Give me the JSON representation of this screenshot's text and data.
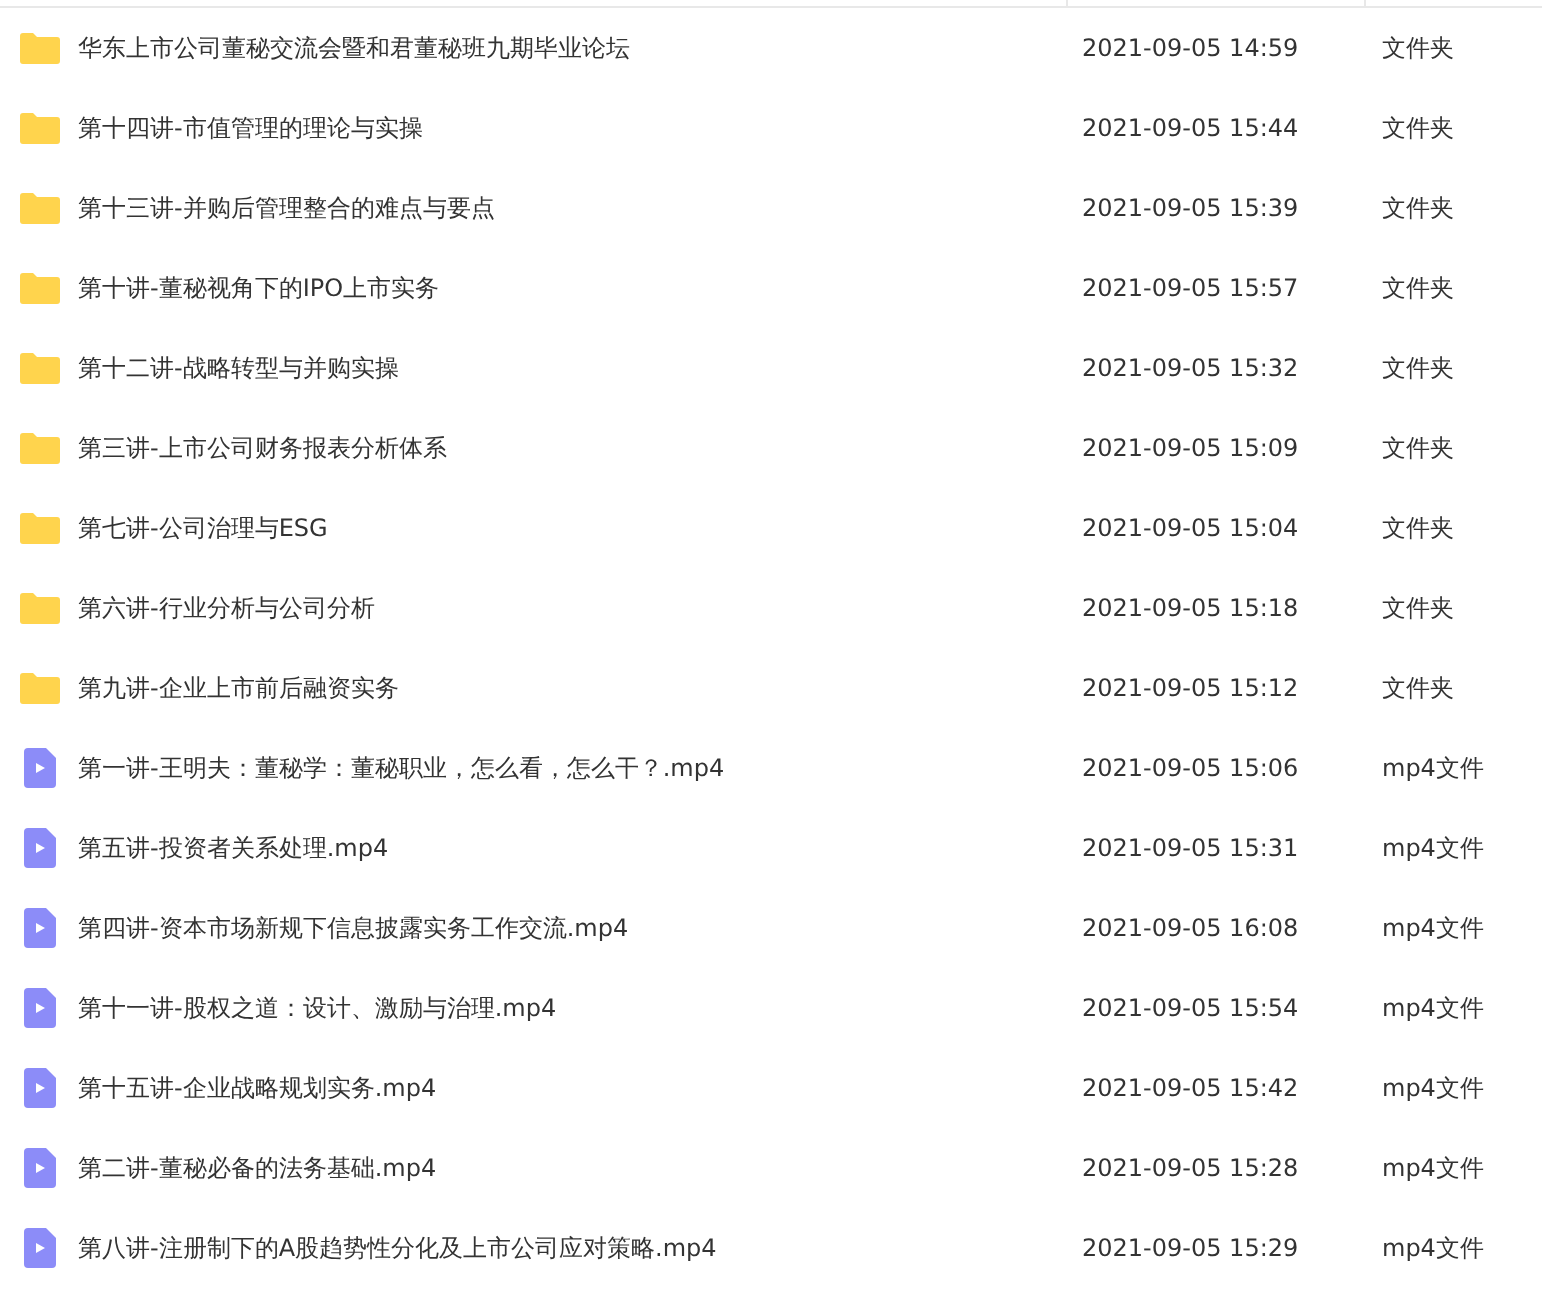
{
  "files": [
    {
      "kind": "folder",
      "name": "华东上市公司董秘交流会暨和君董秘班九期毕业论坛",
      "modified": "2021-09-05 14:59",
      "type": "文件夹"
    },
    {
      "kind": "folder",
      "name": "第十四讲-市值管理的理论与实操",
      "modified": "2021-09-05 15:44",
      "type": "文件夹"
    },
    {
      "kind": "folder",
      "name": "第十三讲-并购后管理整合的难点与要点",
      "modified": "2021-09-05 15:39",
      "type": "文件夹"
    },
    {
      "kind": "folder",
      "name": "第十讲-董秘视角下的IPO上市实务",
      "modified": "2021-09-05 15:57",
      "type": "文件夹"
    },
    {
      "kind": "folder",
      "name": "第十二讲-战略转型与并购实操",
      "modified": "2021-09-05 15:32",
      "type": "文件夹"
    },
    {
      "kind": "folder",
      "name": "第三讲-上市公司财务报表分析体系",
      "modified": "2021-09-05 15:09",
      "type": "文件夹"
    },
    {
      "kind": "folder",
      "name": "第七讲-公司治理与ESG",
      "modified": "2021-09-05 15:04",
      "type": "文件夹"
    },
    {
      "kind": "folder",
      "name": "第六讲-行业分析与公司分析",
      "modified": "2021-09-05 15:18",
      "type": "文件夹"
    },
    {
      "kind": "folder",
      "name": "第九讲-企业上市前后融资实务",
      "modified": "2021-09-05 15:12",
      "type": "文件夹"
    },
    {
      "kind": "video",
      "name": "第一讲-王明夫：董秘学：董秘职业，怎么看，怎么干？.mp4",
      "modified": "2021-09-05 15:06",
      "type": "mp4文件"
    },
    {
      "kind": "video",
      "name": "第五讲-投资者关系处理.mp4",
      "modified": "2021-09-05 15:31",
      "type": "mp4文件"
    },
    {
      "kind": "video",
      "name": "第四讲-资本市场新规下信息披露实务工作交流.mp4",
      "modified": "2021-09-05 16:08",
      "type": "mp4文件"
    },
    {
      "kind": "video",
      "name": "第十一讲-股权之道：设计、激励与治理.mp4",
      "modified": "2021-09-05 15:54",
      "type": "mp4文件"
    },
    {
      "kind": "video",
      "name": "第十五讲-企业战略规划实务.mp4",
      "modified": "2021-09-05 15:42",
      "type": "mp4文件"
    },
    {
      "kind": "video",
      "name": "第二讲-董秘必备的法务基础.mp4",
      "modified": "2021-09-05 15:28",
      "type": "mp4文件"
    },
    {
      "kind": "video",
      "name": "第八讲-注册制下的A股趋势性分化及上市公司应对策略.mp4",
      "modified": "2021-09-05 15:29",
      "type": "mp4文件"
    }
  ]
}
